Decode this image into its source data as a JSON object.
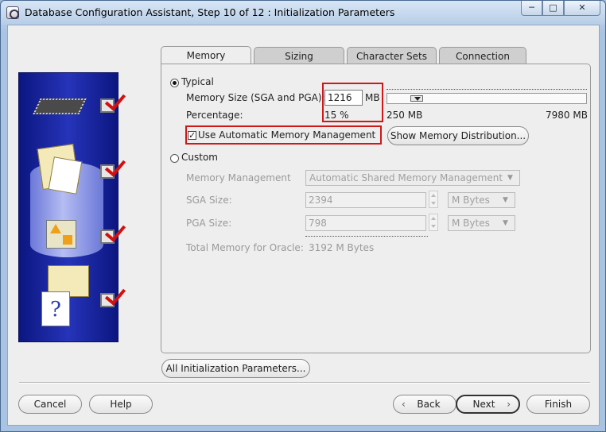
{
  "window": {
    "title": "Database Configuration Assistant, Step 10 of 12 : Initialization Parameters",
    "controls": [
      "─",
      "□",
      "✕"
    ]
  },
  "tabs": [
    {
      "label": "Memory",
      "active": true
    },
    {
      "label": "Sizing",
      "active": false
    },
    {
      "label": "Character Sets",
      "active": false
    },
    {
      "label": "Connection Mode",
      "active": false
    }
  ],
  "typical": {
    "label": "Typical",
    "selected": true,
    "memory_size_label": "Memory Size (SGA and PGA):",
    "memory_size_value": "1216",
    "memory_size_unit": "MB",
    "percentage_label": "Percentage:",
    "percentage_value": "15 %",
    "slider_min": "250 MB",
    "slider_max": "7980 MB",
    "slider_fraction": 0.125,
    "auto_mem_label": "Use Automatic Memory Management",
    "auto_mem_checked": true,
    "show_dist_button": "Show Memory Distribution..."
  },
  "custom": {
    "label": "Custom",
    "selected": false,
    "mem_mgmt_label": "Memory Management",
    "mem_mgmt_value": "Automatic Shared Memory Management",
    "sga_label": "SGA Size:",
    "sga_value": "2394",
    "sga_unit": "M Bytes",
    "pga_label": "PGA Size:",
    "pga_value": "798",
    "pga_unit": "M Bytes",
    "total_label": "Total Memory for Oracle:",
    "total_value": "3192 M Bytes"
  },
  "all_params_button": "All Initialization Parameters...",
  "footer": {
    "cancel": "Cancel",
    "help": "Help",
    "back": "Back",
    "next": "Next",
    "finish": "Finish"
  },
  "colors": {
    "side_panel": "#1c28a8",
    "highlight": "#d01818",
    "check": "#d21010"
  }
}
